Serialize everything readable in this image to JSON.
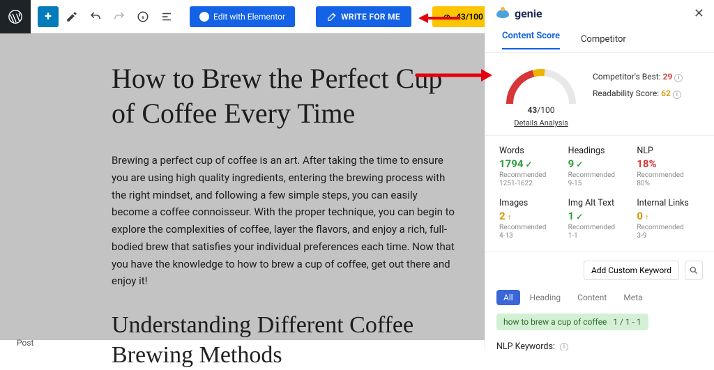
{
  "toolbar": {
    "editElementor": "Edit with Elementor",
    "writeForMe": "WRITE FOR ME",
    "scoreBadge": "43/100"
  },
  "editor": {
    "title": "How to Brew the Perfect Cup of Coffee Every Time",
    "paragraph": "Brewing a perfect cup of coffee is an art. After taking the time to ensure you are using high quality ingredients, entering the brewing process with the right mindset, and following a few simple steps, you can easily become a coffee connoisseur. With the proper technique, you can begin to explore the complexities of coffee, layer the flavors, and enjoy a rich, full-bodied brew that satisfies your individual preferences each time. Now that you have the knowledge to how to brew a cup of coffee, get out there and enjoy it!",
    "h2": "Understanding Different Coffee Brewing Methods",
    "footerLabel": "Post"
  },
  "panel": {
    "brand": "genie",
    "tabs": {
      "contentScore": "Content Score",
      "competitor": "Competitor"
    },
    "gauge": {
      "value": "43",
      "max": "/100",
      "detailsLink": "Details Analysis"
    },
    "compStats": {
      "bestLabel": "Competitor's Best:",
      "bestValue": "29",
      "readLabel": "Readability Score:",
      "readValue": "62"
    },
    "metrics": {
      "words": {
        "label": "Words",
        "value": "1794",
        "recLabel": "Recommended",
        "rec": "1251-1622"
      },
      "headings": {
        "label": "Headings",
        "value": "9",
        "recLabel": "Recommended",
        "rec": "9-15"
      },
      "nlp": {
        "label": "NLP",
        "value": "18%",
        "recLabel": "Recommended",
        "rec": "80%"
      },
      "images": {
        "label": "Images",
        "value": "2",
        "recLabel": "Recommended",
        "rec": "4-13"
      },
      "imgAlt": {
        "label": "Img Alt Text",
        "value": "1",
        "recLabel": "Recommended",
        "rec": "1-1"
      },
      "internalLinks": {
        "label": "Internal Links",
        "value": "0",
        "recLabel": "Recommended",
        "rec": "3-9"
      }
    },
    "keywords": {
      "addButton": "Add Custom Keyword",
      "filters": {
        "all": "All",
        "heading": "Heading",
        "content": "Content",
        "meta": "Meta"
      },
      "chip": {
        "text": "how to brew a cup of coffee",
        "count": "1 / 1 - 1"
      },
      "nlpLabel": "NLP Keywords:"
    }
  },
  "chart_data": {
    "type": "gauge",
    "title": "Content Score",
    "value": 43,
    "min": 0,
    "max": 100,
    "segments": [
      {
        "color": "#d63638",
        "range": [
          0,
          43
        ]
      },
      {
        "color": "#f0b400",
        "range": [
          43,
          55
        ]
      },
      {
        "color": "#e8e8e8",
        "range": [
          55,
          100
        ]
      }
    ]
  }
}
